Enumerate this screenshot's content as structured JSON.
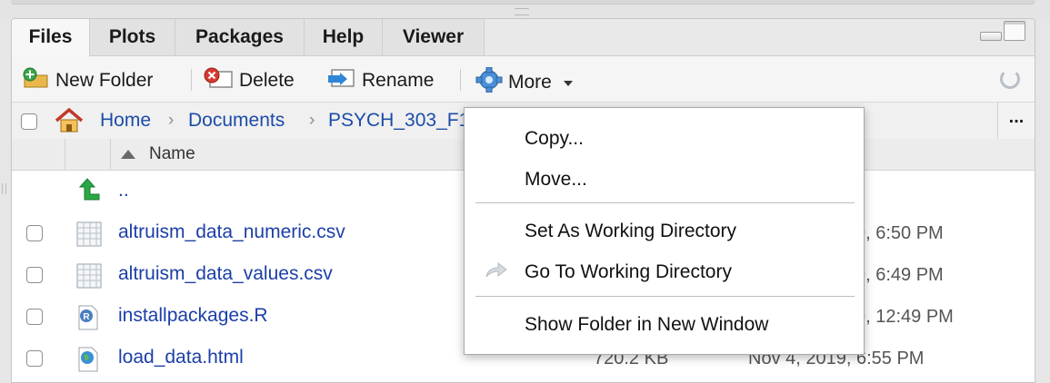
{
  "tabs": [
    {
      "label": "Files",
      "active": true
    },
    {
      "label": "Plots",
      "active": false
    },
    {
      "label": "Packages",
      "active": false
    },
    {
      "label": "Help",
      "active": false
    },
    {
      "label": "Viewer",
      "active": false
    }
  ],
  "toolbar": {
    "new_folder": "New Folder",
    "delete": "Delete",
    "rename": "Rename",
    "more": "More"
  },
  "breadcrumb": {
    "home": "Home",
    "documents": "Documents",
    "folder": "PSYCH_303_F1",
    "more": "..."
  },
  "columns": {
    "name": "Name"
  },
  "files": [
    {
      "name": "..",
      "type": "parent",
      "size": "",
      "modified": ""
    },
    {
      "name": "altruism_data_numeric.csv",
      "type": "csv",
      "size": "",
      "modified": "9, 6:50 PM"
    },
    {
      "name": "altruism_data_values.csv",
      "type": "csv",
      "size": "",
      "modified": "9, 6:49 PM"
    },
    {
      "name": "installpackages.R",
      "type": "r",
      "size": "",
      "modified": "9, 12:49 PM"
    },
    {
      "name": "load_data.html",
      "type": "html",
      "size": "720.2 KB",
      "modified": "Nov 4, 2019, 6:55 PM"
    }
  ],
  "more_menu": {
    "items": [
      {
        "label": "Copy..."
      },
      {
        "label": "Move..."
      },
      {
        "label": "Set As Working Directory"
      },
      {
        "label": "Go To Working Directory"
      },
      {
        "label": "Show Folder in New Window"
      }
    ]
  },
  "colors": {
    "link": "#1c3fa8",
    "breadcrumb": "#1c4ca8",
    "tab_active": "#f7f7f7",
    "parent_arrow": "#2aa845"
  }
}
